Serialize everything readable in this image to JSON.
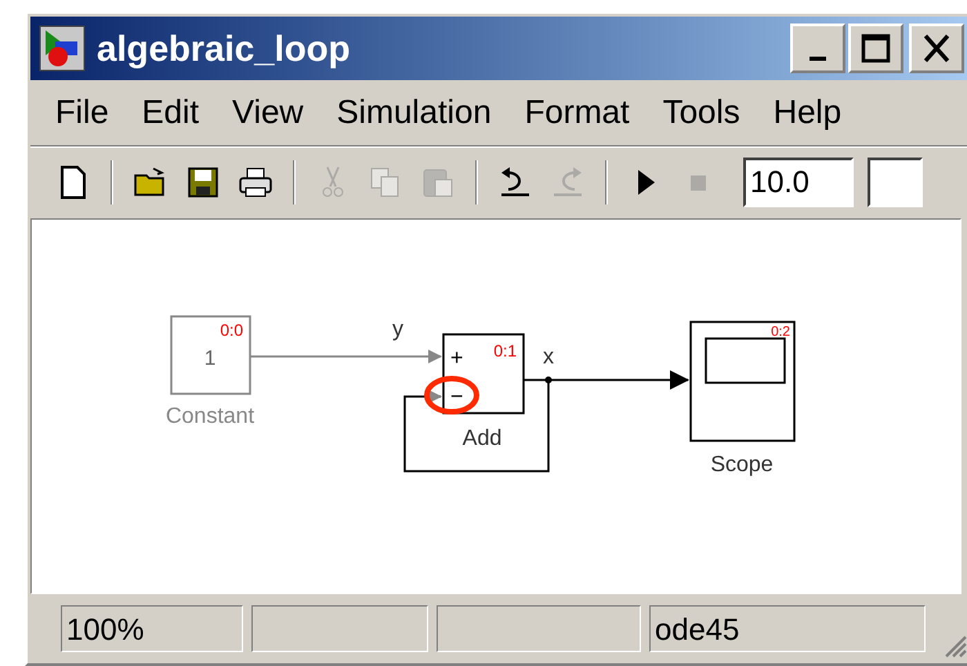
{
  "window": {
    "title": "algebraic_loop"
  },
  "menu": [
    "File",
    "Edit",
    "View",
    "Simulation",
    "Format",
    "Tools",
    "Help"
  ],
  "toolbar": [
    {
      "kind": "new",
      "disabled": false
    },
    {
      "kind": "separator"
    },
    {
      "kind": "open",
      "disabled": false
    },
    {
      "kind": "save",
      "disabled": false
    },
    {
      "kind": "print",
      "disabled": false
    },
    {
      "kind": "separator"
    },
    {
      "kind": "cut",
      "disabled": true
    },
    {
      "kind": "copy",
      "disabled": true
    },
    {
      "kind": "paste",
      "disabled": true
    },
    {
      "kind": "separator"
    },
    {
      "kind": "undo",
      "disabled": false
    },
    {
      "kind": "redo",
      "disabled": true
    },
    {
      "kind": "separator"
    },
    {
      "kind": "start",
      "disabled": false
    },
    {
      "kind": "stop",
      "disabled": true
    }
  ],
  "stop_time": {
    "value": "10.0"
  },
  "diagram": {
    "blocks": [
      {
        "name": "Constant",
        "value": "1",
        "sample_time": "0:0",
        "selected": false
      },
      {
        "name": "Add",
        "signs": [
          "+",
          "−"
        ],
        "sample_time": "0:1",
        "selected": true
      },
      {
        "name": "Scope",
        "sample_time": "0:2",
        "selected": true
      }
    ],
    "signals": [
      {
        "label": "y"
      },
      {
        "label": "x"
      }
    ]
  },
  "status_bar": [
    {
      "kind": "text",
      "text": "100%"
    },
    {
      "kind": "empty"
    },
    {
      "kind": "empty"
    },
    {
      "kind": "text",
      "text": "ode45"
    }
  ]
}
